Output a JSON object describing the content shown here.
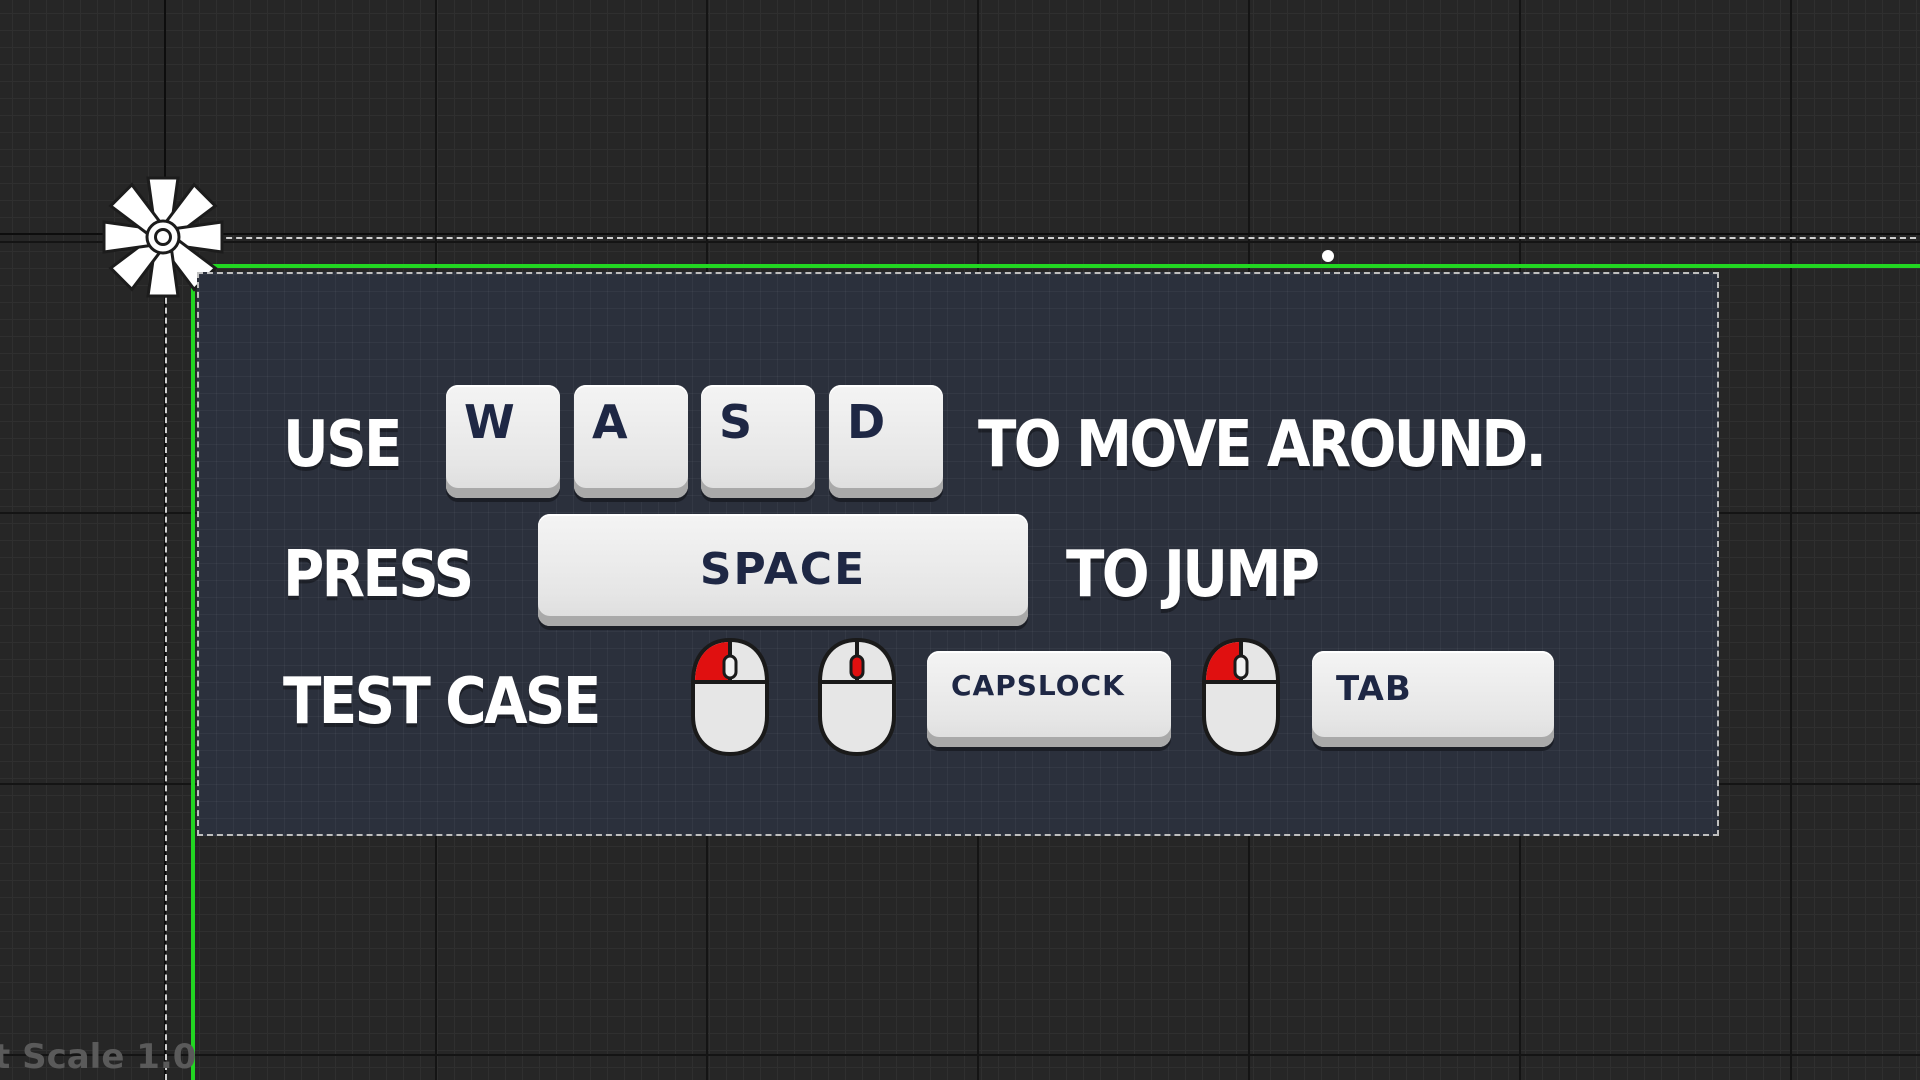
{
  "viewport": {
    "scale_label": "t Scale 1.0"
  },
  "panel": {
    "row1": {
      "prefix": "USE",
      "keys": [
        "W",
        "A",
        "S",
        "D"
      ],
      "suffix": "TO MOVE AROUND."
    },
    "row2": {
      "prefix": "PRESS",
      "key": "SPACE",
      "suffix": "TO JUMP"
    },
    "row3": {
      "prefix": "TEST CASE",
      "inputs": [
        {
          "type": "mouse",
          "icon": "mouse-left-click-icon"
        },
        {
          "type": "mouse",
          "icon": "mouse-middle-click-icon"
        },
        {
          "type": "key",
          "label": "CAPSLOCK"
        },
        {
          "type": "mouse",
          "icon": "mouse-left-click-icon"
        },
        {
          "type": "key",
          "label": "TAB"
        }
      ]
    }
  },
  "colors": {
    "background": "#262626",
    "panel": "#2b303c",
    "safe_zone": "#22d622",
    "key_face": "#ececec",
    "key_text": "#1e2744",
    "mouse_highlight": "#e01010"
  }
}
